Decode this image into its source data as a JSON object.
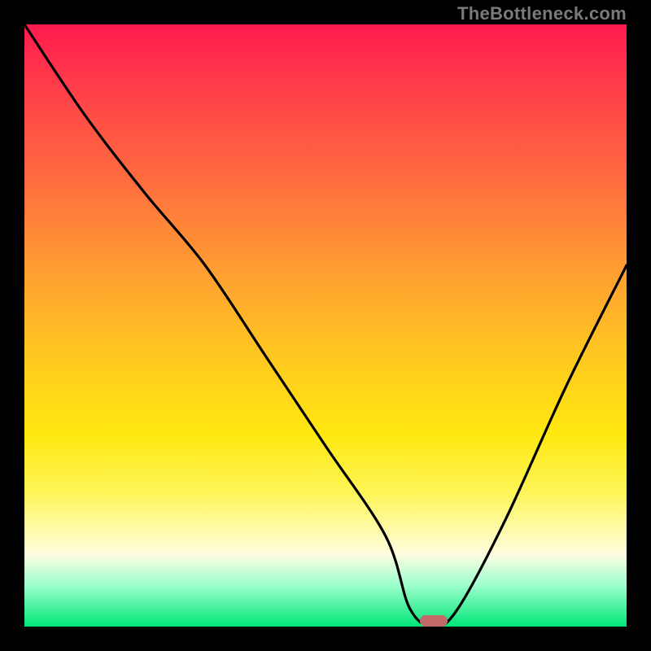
{
  "watermark": "TheBottleneck.com",
  "chart_data": {
    "type": "line",
    "title": "",
    "xlabel": "",
    "ylabel": "",
    "xlim": [
      0,
      100
    ],
    "ylim": [
      0,
      100
    ],
    "series": [
      {
        "name": "bottleneck-curve",
        "x": [
          0,
          10,
          20,
          30,
          40,
          50,
          60,
          64,
          68,
          72,
          80,
          90,
          100
        ],
        "values": [
          100,
          85,
          72,
          60,
          45,
          30,
          15,
          3,
          0,
          3,
          18,
          40,
          60
        ]
      }
    ],
    "optimal_point": {
      "x": 68,
      "y": 0
    },
    "marker_color": "#c46a6a"
  }
}
